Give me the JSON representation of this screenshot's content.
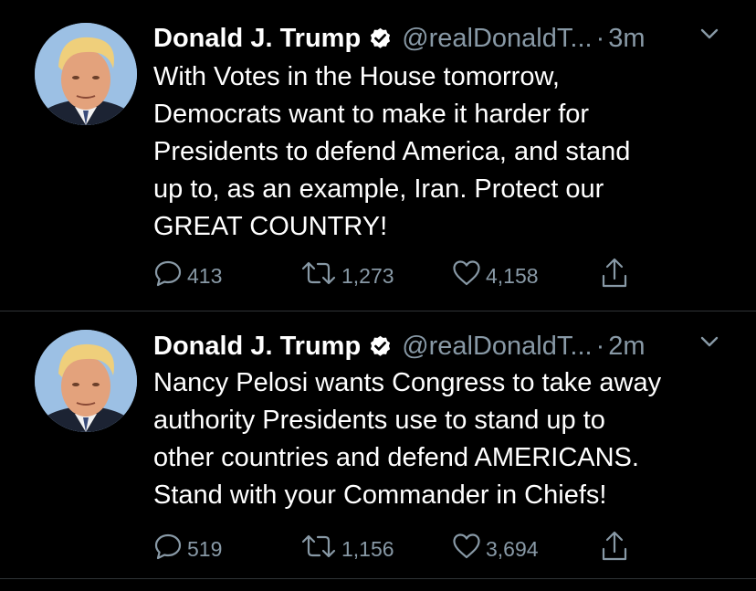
{
  "tweets": [
    {
      "name": "Donald J. Trump",
      "handle": "@realDonaldT...",
      "separator": "·",
      "time": "3m",
      "lines": [
        "With Votes in the House tomorrow,",
        "Democrats want to make it harder for",
        "Presidents to defend America, and stand",
        "up to, as an example, Iran. Protect our",
        "GREAT COUNTRY!"
      ],
      "replies": "413",
      "retweets": "1,273",
      "likes": "4,158"
    },
    {
      "name": "Donald J. Trump",
      "handle": "@realDonaldT...",
      "separator": "·",
      "time": "2m",
      "lines": [
        "Nancy Pelosi wants Congress to take away",
        "authority Presidents use to stand up to",
        "other countries and defend AMERICANS.",
        "Stand with your Commander in Chiefs!"
      ],
      "replies": "519",
      "retweets": "1,156",
      "likes": "3,694"
    }
  ],
  "icons": {
    "verified": "verified-badge-icon",
    "caret": "chevron-down-icon",
    "reply": "reply-icon",
    "retweet": "retweet-icon",
    "like": "heart-icon",
    "share": "share-icon"
  },
  "colors": {
    "background": "#000000",
    "text": "#ffffff",
    "secondary": "#8899a6",
    "divider": "#2f3336"
  }
}
